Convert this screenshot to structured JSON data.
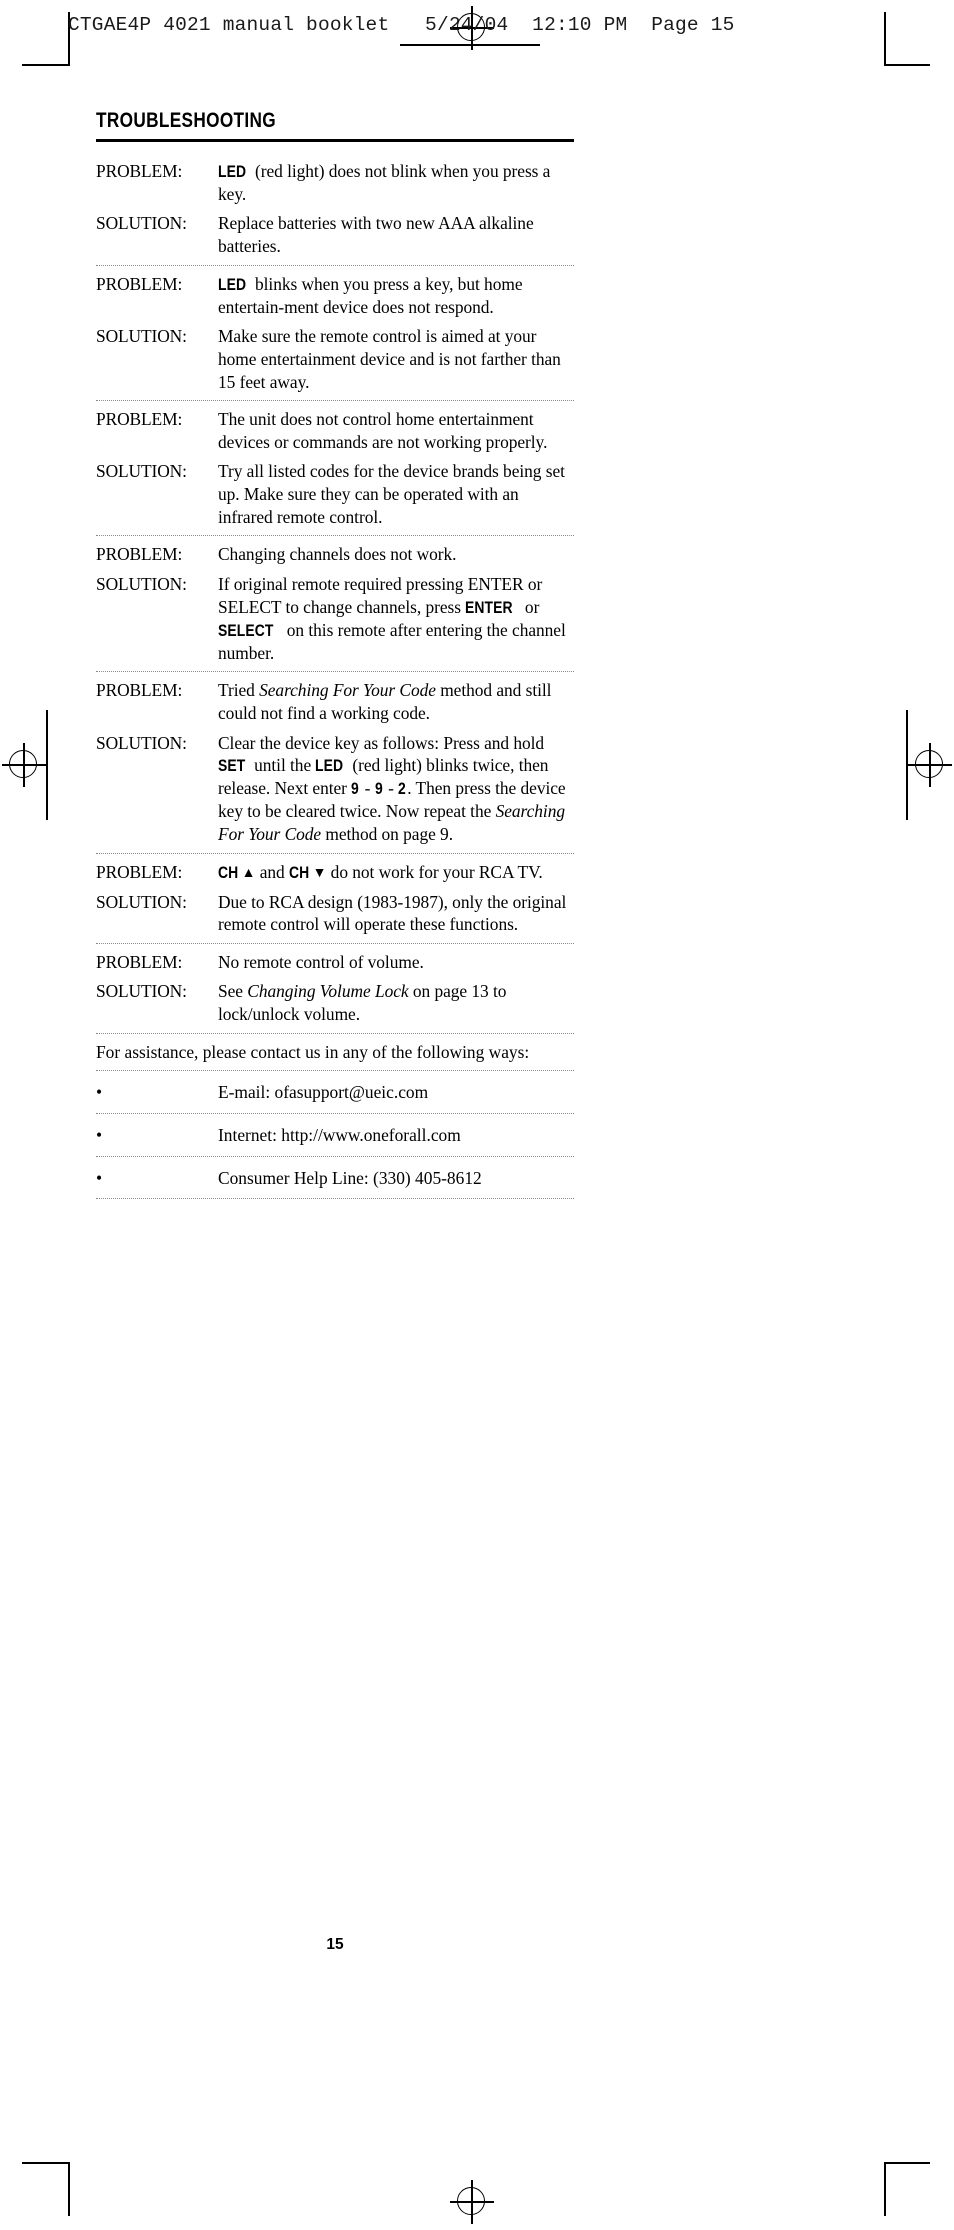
{
  "proof_header": {
    "text": "CTGAE4P 4021 manual booklet   5/24/04  12:10 PM  Page 15"
  },
  "page": {
    "title": "TROUBLESHOOTING",
    "folio": "15"
  },
  "labels": {
    "problem": "PROBLEM:",
    "solution": "SOLUTION:",
    "bullet": "•"
  },
  "entries": [
    {
      "problem_parts": [
        {
          "text": "LED",
          "style": "kb"
        },
        {
          "text": " (red light) does not blink when you press a key.",
          "style": "normal"
        }
      ],
      "solution_parts": [
        {
          "text": "Replace batteries with two new AAA alkaline batteries.",
          "style": "normal"
        }
      ]
    },
    {
      "problem_parts": [
        {
          "text": "LED",
          "style": "kb"
        },
        {
          "text": " blinks when you press a key, but home entertain-ment device does not respond.",
          "style": "normal"
        }
      ],
      "solution_parts": [
        {
          "text": "Make sure the remote control is aimed at your home entertainment device and is not farther than 15 feet away.",
          "style": "normal"
        }
      ]
    },
    {
      "problem_parts": [
        {
          "text": "The unit does not control home entertainment devices or commands are not working properly.",
          "style": "normal"
        }
      ],
      "solution_parts": [
        {
          "text": "Try all listed codes for the device brands being set up. Make sure they can be operated with an infrared remote control.",
          "style": "normal"
        }
      ]
    },
    {
      "problem_parts": [
        {
          "text": "Changing channels does not work.",
          "style": "normal"
        }
      ],
      "solution_parts": [
        {
          "text": "If original remote required pressing ENTER or SELECT to change channels, press ",
          "style": "normal"
        },
        {
          "text": "ENTER",
          "style": "kb"
        },
        {
          "text": " or ",
          "style": "normal"
        },
        {
          "text": "SELECT",
          "style": "kb"
        },
        {
          "text": " on this remote after entering the channel number.",
          "style": "normal"
        }
      ]
    },
    {
      "problem_parts": [
        {
          "text": "Tried ",
          "style": "normal"
        },
        {
          "text": "Searching For Your Code",
          "style": "it"
        },
        {
          "text": " method and still could not find a working code.",
          "style": "normal"
        }
      ],
      "solution_parts": [
        {
          "text": "Clear the device key as follows: Press and hold ",
          "style": "normal"
        },
        {
          "text": "SET",
          "style": "kb"
        },
        {
          "text": " until the ",
          "style": "normal"
        },
        {
          "text": "LED",
          "style": "kb"
        },
        {
          "text": " (red light) blinks twice, then release. Next enter ",
          "style": "normal"
        },
        {
          "text": "9",
          "style": "kb"
        },
        {
          "text": " - ",
          "style": "normal"
        },
        {
          "text": "9",
          "style": "kb"
        },
        {
          "text": " - ",
          "style": "normal"
        },
        {
          "text": "2",
          "style": "kb"
        },
        {
          "text": ". Then press the device key to be cleared twice. Now repeat the ",
          "style": "normal"
        },
        {
          "text": "Searching For Your Code",
          "style": "it"
        },
        {
          "text": " method on page 9.",
          "style": "normal"
        }
      ]
    },
    {
      "problem_parts": [
        {
          "text": "CH",
          "style": "kb"
        },
        {
          "text": "▲",
          "style": "arrow"
        },
        {
          "text": " and ",
          "style": "normal"
        },
        {
          "text": "CH",
          "style": "kb"
        },
        {
          "text": "▼",
          "style": "arrow"
        },
        {
          "text": " do not work for your RCA TV.",
          "style": "normal"
        }
      ],
      "solution_parts": [
        {
          "text": "Due to RCA design (1983-1987), only the original remote control  will operate these functions.",
          "style": "normal"
        }
      ]
    },
    {
      "problem_parts": [
        {
          "text": "No remote control of volume.",
          "style": "normal"
        }
      ],
      "solution_parts": [
        {
          "text": "See ",
          "style": "normal"
        },
        {
          "text": "Changing Volume Lock",
          "style": "it"
        },
        {
          "text": " on page 13 to lock/unlock volume.",
          "style": "normal"
        }
      ]
    }
  ],
  "assistance": {
    "intro": "For assistance, please contact us in any of the following ways:",
    "contacts": [
      "E-mail: ofasupport@ueic.com",
      "Internet: http://www.oneforall.com",
      "Consumer Help Line: (330) 405-8612"
    ]
  }
}
